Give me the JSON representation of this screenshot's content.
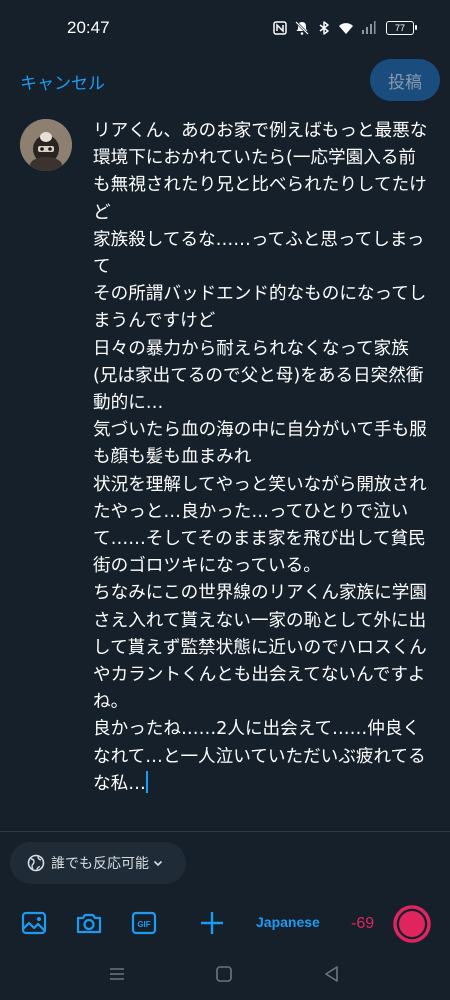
{
  "status_bar": {
    "time": "20:47",
    "battery": "77",
    "icons": [
      "nfc-icon",
      "mute-icon",
      "bluetooth-icon",
      "wifi-icon",
      "signal-icon",
      "battery-icon"
    ]
  },
  "header": {
    "cancel_label": "キャンセル",
    "post_label": "投稿"
  },
  "compose": {
    "text": "リアくん、あのお家で例えばもっと最悪な環境下におかれていたら(一応学園入る前も無視されたり兄と比べられたりしてたけど\n家族殺してるな……ってふと思ってしまって\nその所謂バッドエンド的なものになってしまうんですけど\n日々の暴力から耐えられなくなって家族(兄は家出てるので父と母)をある日突然衝動的に…\n気づいたら血の海の中に自分がいて手も服も顔も髪も血まみれ\n状況を理解してやっと笑いながら開放されたやっと…良かった…ってひとりで泣いて……そしてそのまま家を飛び出して貧民街のゴロツキになっている。\nちなみにこの世界線のリアくん家族に学園さえ入れて貰えない一家の恥として外に出して貰えず監禁状態に近いのでハロスくんやカラントくんとも出会えてないんですよね。\n良かったね……2人に出会えて……仲良くなれて…と一人泣いていただいぶ疲れてるな私…"
  },
  "reply_setting": {
    "label": "誰でも反応可能"
  },
  "toolbar": {
    "icons": [
      "image-icon",
      "camera-icon",
      "gif-icon",
      "add-icon"
    ],
    "gif_label": "GIF",
    "language": "Japanese",
    "counter": "-69"
  },
  "colors": {
    "background": "#15202b",
    "accent": "#1d9bf0",
    "post_button": "#1a4c7e",
    "over_limit": "#e0245e"
  }
}
